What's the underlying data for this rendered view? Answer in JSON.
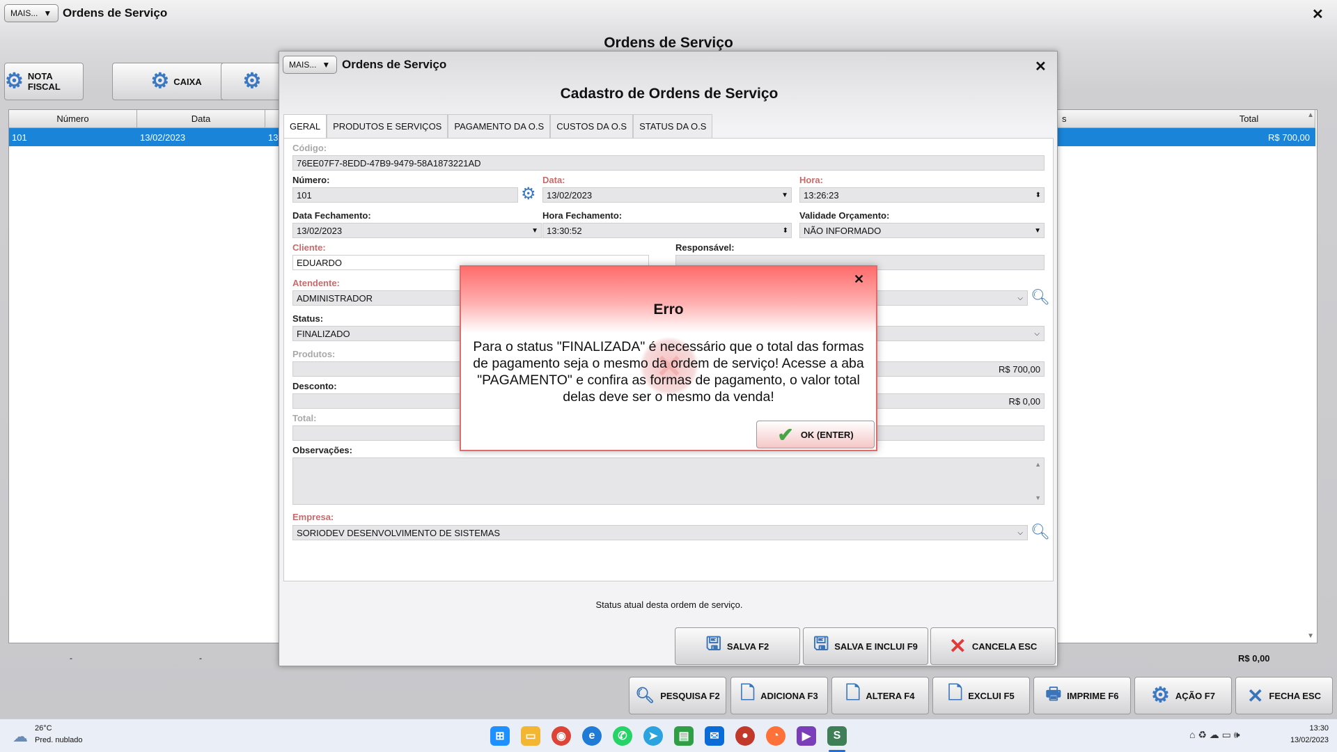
{
  "main": {
    "mais_label": "MAIS...",
    "title": "Ordens de Serviço",
    "heading": "Ordens de Serviço",
    "toolbar": {
      "nota_fiscal": "NOTA FISCAL",
      "caixa": "CAIXA"
    },
    "grid": {
      "columns": {
        "numero": "Número",
        "data": "Data",
        "s": "s",
        "total": "Total"
      },
      "row": {
        "numero": "101",
        "data": "13/02/2023",
        "data2": "13",
        "total": "R$ 700,00"
      },
      "footer_total": "R$ 0,00",
      "footer_dash1": "-",
      "footer_dash2": "-"
    },
    "bottom_buttons": {
      "pesquisa": "PESQUISA F2",
      "adiciona": "ADICIONA F3",
      "altera": "ALTERA F4",
      "exclui": "EXCLUI F5",
      "imprime": "IMPRIME F6",
      "acao": "AÇÃO F7",
      "fecha": "FECHA ESC"
    }
  },
  "cadastro": {
    "mais_label": "MAIS...",
    "title": "Ordens de Serviço",
    "heading": "Cadastro de Ordens de Serviço",
    "tabs": [
      "GERAL",
      "PRODUTOS E SERVIÇOS",
      "PAGAMENTO DA O.S",
      "CUSTOS DA O.S",
      "STATUS DA O.S"
    ],
    "fields": {
      "codigo_label": "Código:",
      "codigo": "76EE07F7-8EDD-47B9-9479-58A1873221AD",
      "numero_label": "Número:",
      "numero": "101",
      "data_label": "Data:",
      "data": "13/02/2023",
      "hora_label": "Hora:",
      "hora": "13:26:23",
      "data_fech_label": "Data Fechamento:",
      "data_fech": "13/02/2023",
      "hora_fech_label": "Hora Fechamento:",
      "hora_fech": "13:30:52",
      "validade_label": "Validade Orçamento:",
      "validade": "NÃO INFORMADO",
      "cliente_label": "Cliente:",
      "cliente": "EDUARDO",
      "responsavel_label": "Responsável:",
      "atendente_label": "Atendente:",
      "atendente": "ADMINISTRADOR",
      "status_label": "Status:",
      "status": "FINALIZADO",
      "produtos_label": "Produtos:",
      "produtos": "R$ 700,00",
      "desconto_label": "Desconto:",
      "desconto": "R$ 0,00",
      "total_label": "Total:",
      "obs_label": "Observações:",
      "empresa_label": "Empresa:",
      "empresa": "SORIODEV DESENVOLVIMENTO DE SISTEMAS"
    },
    "status_hint": "Status atual desta ordem de serviço.",
    "buttons": {
      "salva": "SALVA F2",
      "salva_inclui": "SALVA E INCLUI F9",
      "cancela": "CANCELA ESC"
    }
  },
  "error": {
    "title": "Erro",
    "message": "Para o status \"FINALIZADA\" é necessário que o total das formas de pagamento seja o mesmo da ordem de serviço! Acesse a aba \"PAGAMENTO\" e confira as formas de pagamento, o valor total delas deve ser o mesmo da venda!",
    "ok": "OK (ENTER)"
  },
  "taskbar": {
    "temp": "26°C",
    "weather": "Pred. nublado",
    "time": "13:30",
    "date": "13/02/2023"
  }
}
